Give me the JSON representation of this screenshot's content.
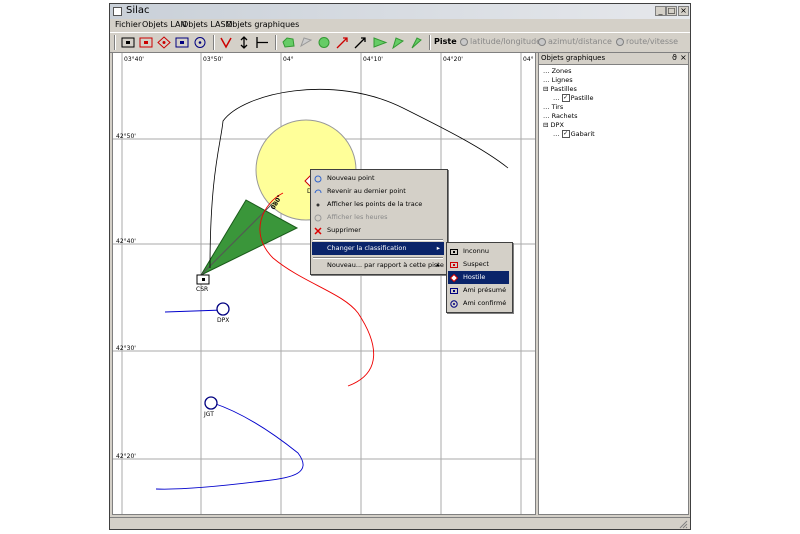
{
  "window": {
    "title": "Silac",
    "min": "_",
    "max": "□",
    "close": "×"
  },
  "menu": [
    "Fichier",
    "Objets LAN",
    "Objets LASM",
    "Objets graphiques"
  ],
  "toolbar": {
    "piste_label": "Piste",
    "radios": [
      "latitude/longitude",
      "azimut/distance",
      "route/vitesse"
    ]
  },
  "map": {
    "lon_labels": [
      "03°40'",
      "03°50'",
      "04°",
      "04°10'",
      "04°20'",
      "04°"
    ],
    "lat_labels": [
      "42°50'",
      "42°40'",
      "42°30'",
      "42°20'"
    ],
    "track_labels": {
      "csr": "CSR",
      "dpx": "DPX",
      "jgt": "JGT",
      "dc": "DC",
      "bearing": "080°"
    }
  },
  "panel": {
    "title": "Objets graphiques",
    "pin": "ϑ",
    "close": "×",
    "tree": [
      {
        "label": "Zones",
        "prefix": "…",
        "level": 0
      },
      {
        "label": "Lignes",
        "prefix": "…",
        "level": 0
      },
      {
        "label": "Pastilles",
        "prefix": "⊟",
        "level": 0
      },
      {
        "label": "Pastille",
        "prefix": "…",
        "level": 1,
        "checked": true
      },
      {
        "label": "Tirs",
        "prefix": "…",
        "level": 0
      },
      {
        "label": "Rachets",
        "prefix": "…",
        "level": 0
      },
      {
        "label": "DPX",
        "prefix": "⊟",
        "level": 0
      },
      {
        "label": "Gabarit",
        "prefix": "…",
        "level": 1,
        "checked": true
      }
    ],
    "check_glyph": "✓"
  },
  "context_menu": {
    "items": [
      {
        "label": "Nouveau point",
        "icon": "new-point-icon",
        "disabled": false
      },
      {
        "label": "Revenir au dernier point",
        "icon": "undo-icon",
        "disabled": false
      },
      {
        "label": "Afficher les points de la trace",
        "icon": "points-icon",
        "disabled": false
      },
      {
        "label": "Afficher les heures",
        "icon": "clock-icon",
        "disabled": true
      },
      {
        "label": "Supprimer",
        "icon": "delete-icon",
        "disabled": false
      },
      {
        "label": "Changer la classification",
        "icon": "",
        "disabled": false,
        "highlight": true,
        "submenu": true
      },
      {
        "label": "Nouveau... par rapport à cette piste",
        "icon": "",
        "disabled": false,
        "submenu": true
      }
    ],
    "arrow": "▸"
  },
  "submenu": {
    "items": [
      {
        "label": "Inconnu",
        "icon": "unknown-icon",
        "color": "#000000"
      },
      {
        "label": "Suspect",
        "icon": "suspect-icon",
        "color": "#c00000"
      },
      {
        "label": "Hostile",
        "icon": "hostile-icon",
        "color": "#c00000",
        "highlight": true
      },
      {
        "label": "Ami présumé",
        "icon": "assumed-friend-icon",
        "color": "#000080"
      },
      {
        "label": "Ami confirmé",
        "icon": "friend-icon",
        "color": "#000080"
      }
    ]
  }
}
